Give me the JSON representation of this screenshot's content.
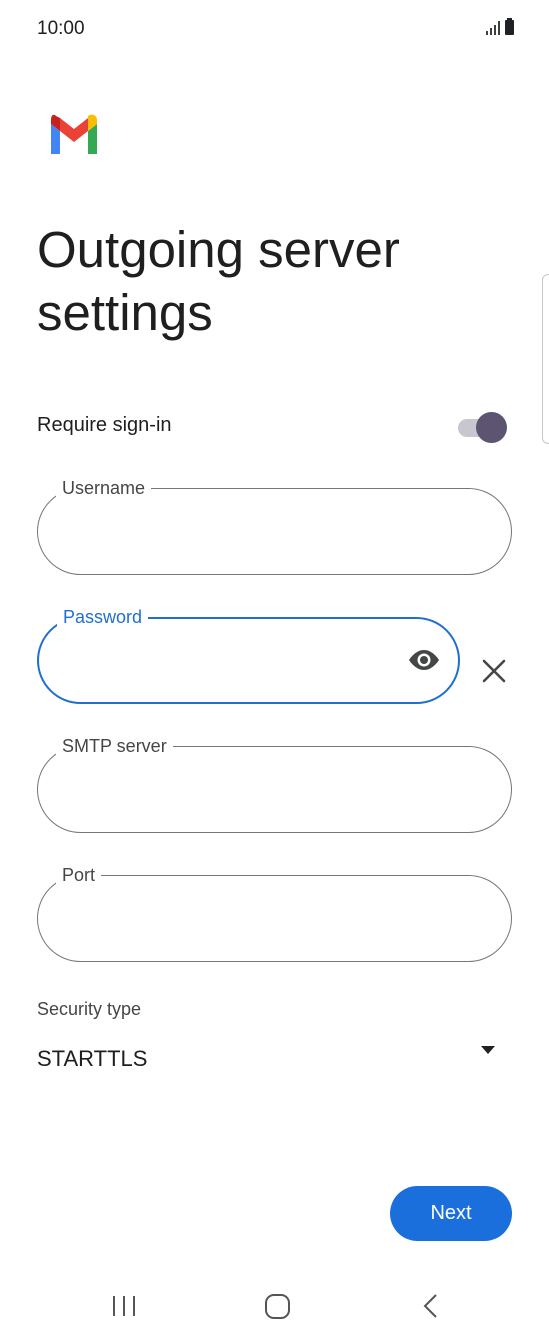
{
  "status_bar": {
    "time": "10:00"
  },
  "app": {
    "logo_icon": "gmail-logo-icon"
  },
  "page": {
    "title": "Outgoing server settings"
  },
  "require_signin": {
    "label": "Require sign-in",
    "enabled": true
  },
  "fields": {
    "username": {
      "label": "Username",
      "value": ""
    },
    "password": {
      "label": "Password",
      "value": ""
    },
    "smtp_server": {
      "label": "SMTP server",
      "value": ""
    },
    "port": {
      "label": "Port",
      "value": ""
    }
  },
  "security": {
    "label": "Security type",
    "selected": "STARTTLS"
  },
  "actions": {
    "next_label": "Next"
  },
  "colors": {
    "accent": "#1b6fdc",
    "focus_border": "#1f6fd1",
    "toggle_thumb": "#5c5470"
  }
}
